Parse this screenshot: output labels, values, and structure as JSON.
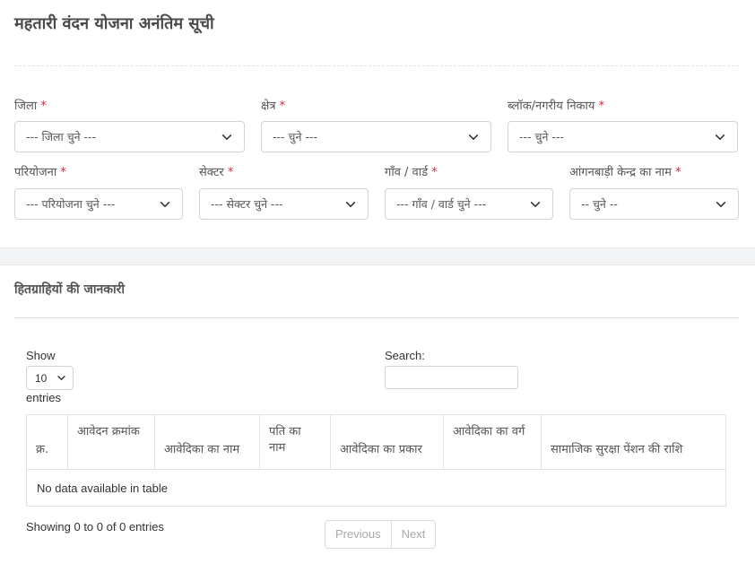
{
  "page": {
    "title": "महतारी वंदन योजना अनंतिम सूची"
  },
  "required_marker": "*",
  "filters": {
    "district": {
      "label": "जिला",
      "value": "--- जिला चुने ---"
    },
    "region": {
      "label": "क्षेत्र",
      "value": "--- चुने ---"
    },
    "block": {
      "label": "ब्लॉक/नगरीय निकाय",
      "value": "--- चुने ---"
    },
    "project": {
      "label": "परियोजना",
      "value": "--- परियोजना चुने ---"
    },
    "sector": {
      "label": "सेक्टर",
      "value": "--- सेक्टर चुने ---"
    },
    "village": {
      "label": "गाँव / वार्ड",
      "value": "--- गाँव / वार्ड चुने ---"
    },
    "anganwadi": {
      "label": "आंगनबाड़ी केन्द्र का नाम",
      "value": "-- चुने --"
    }
  },
  "beneficiaries": {
    "title": "हितग्राहियों की जानकारी",
    "show_label": "Show",
    "page_length": "10",
    "entries_label": "entries",
    "search_label": "Search:",
    "search_value": "",
    "columns": [
      "क्र.",
      "आवेदन क्रमांक",
      "आवेदिका का नाम",
      "पति का नाम",
      "आवेदिका का प्रकार",
      "आवेदिका का वर्ग",
      "सामाजिक सुरक्षा पेंशन की राशि"
    ],
    "empty_message": "No data available in table",
    "info": "Showing 0 to 0 of 0 entries",
    "previous_label": "Previous",
    "next_label": "Next"
  }
}
